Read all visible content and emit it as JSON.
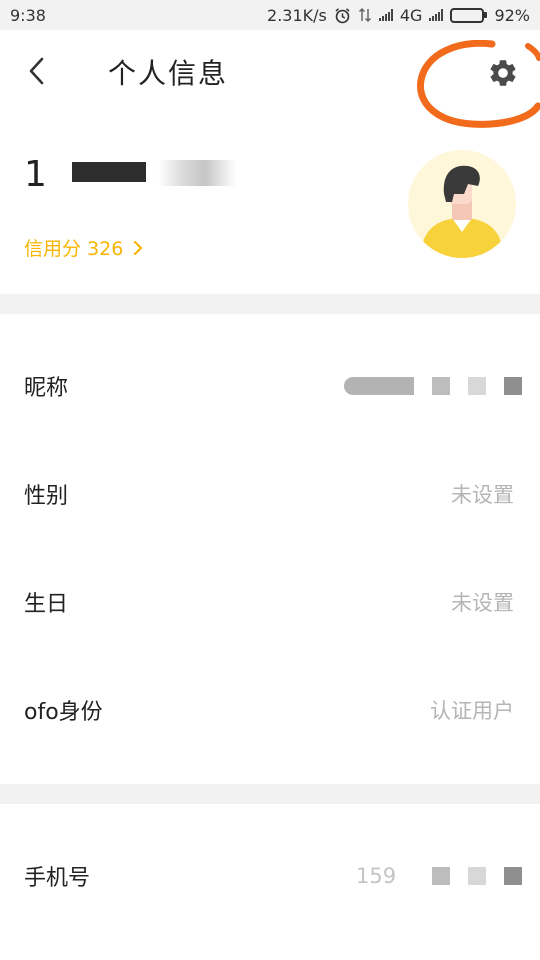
{
  "status_bar": {
    "time": "9:38",
    "speed": "2.31K/s",
    "network": "4G",
    "battery": "92%",
    "battery_level": 0.92,
    "icons": [
      "alarm-icon",
      "data-transfer-icon",
      "signal-icon",
      "signal-icon",
      "battery-icon"
    ]
  },
  "header": {
    "title": "个人信息",
    "back_icon": "chevron-left-icon",
    "settings_icon": "gear-icon",
    "annotation_color": "#f26a1b"
  },
  "profile": {
    "phone_prefix": "1",
    "credit_label": "信用分",
    "credit_score": "326",
    "accent_color": "#f7b500",
    "avatar_icon": "user-avatar-icon"
  },
  "info_rows": [
    {
      "label": "昵称",
      "value": ""
    },
    {
      "label": "性别",
      "value": "未设置"
    },
    {
      "label": "生日",
      "value": "未设置"
    },
    {
      "label": "ofo身份",
      "value": "认证用户"
    }
  ],
  "phone_row": {
    "label": "手机号",
    "value_visible": "159"
  }
}
